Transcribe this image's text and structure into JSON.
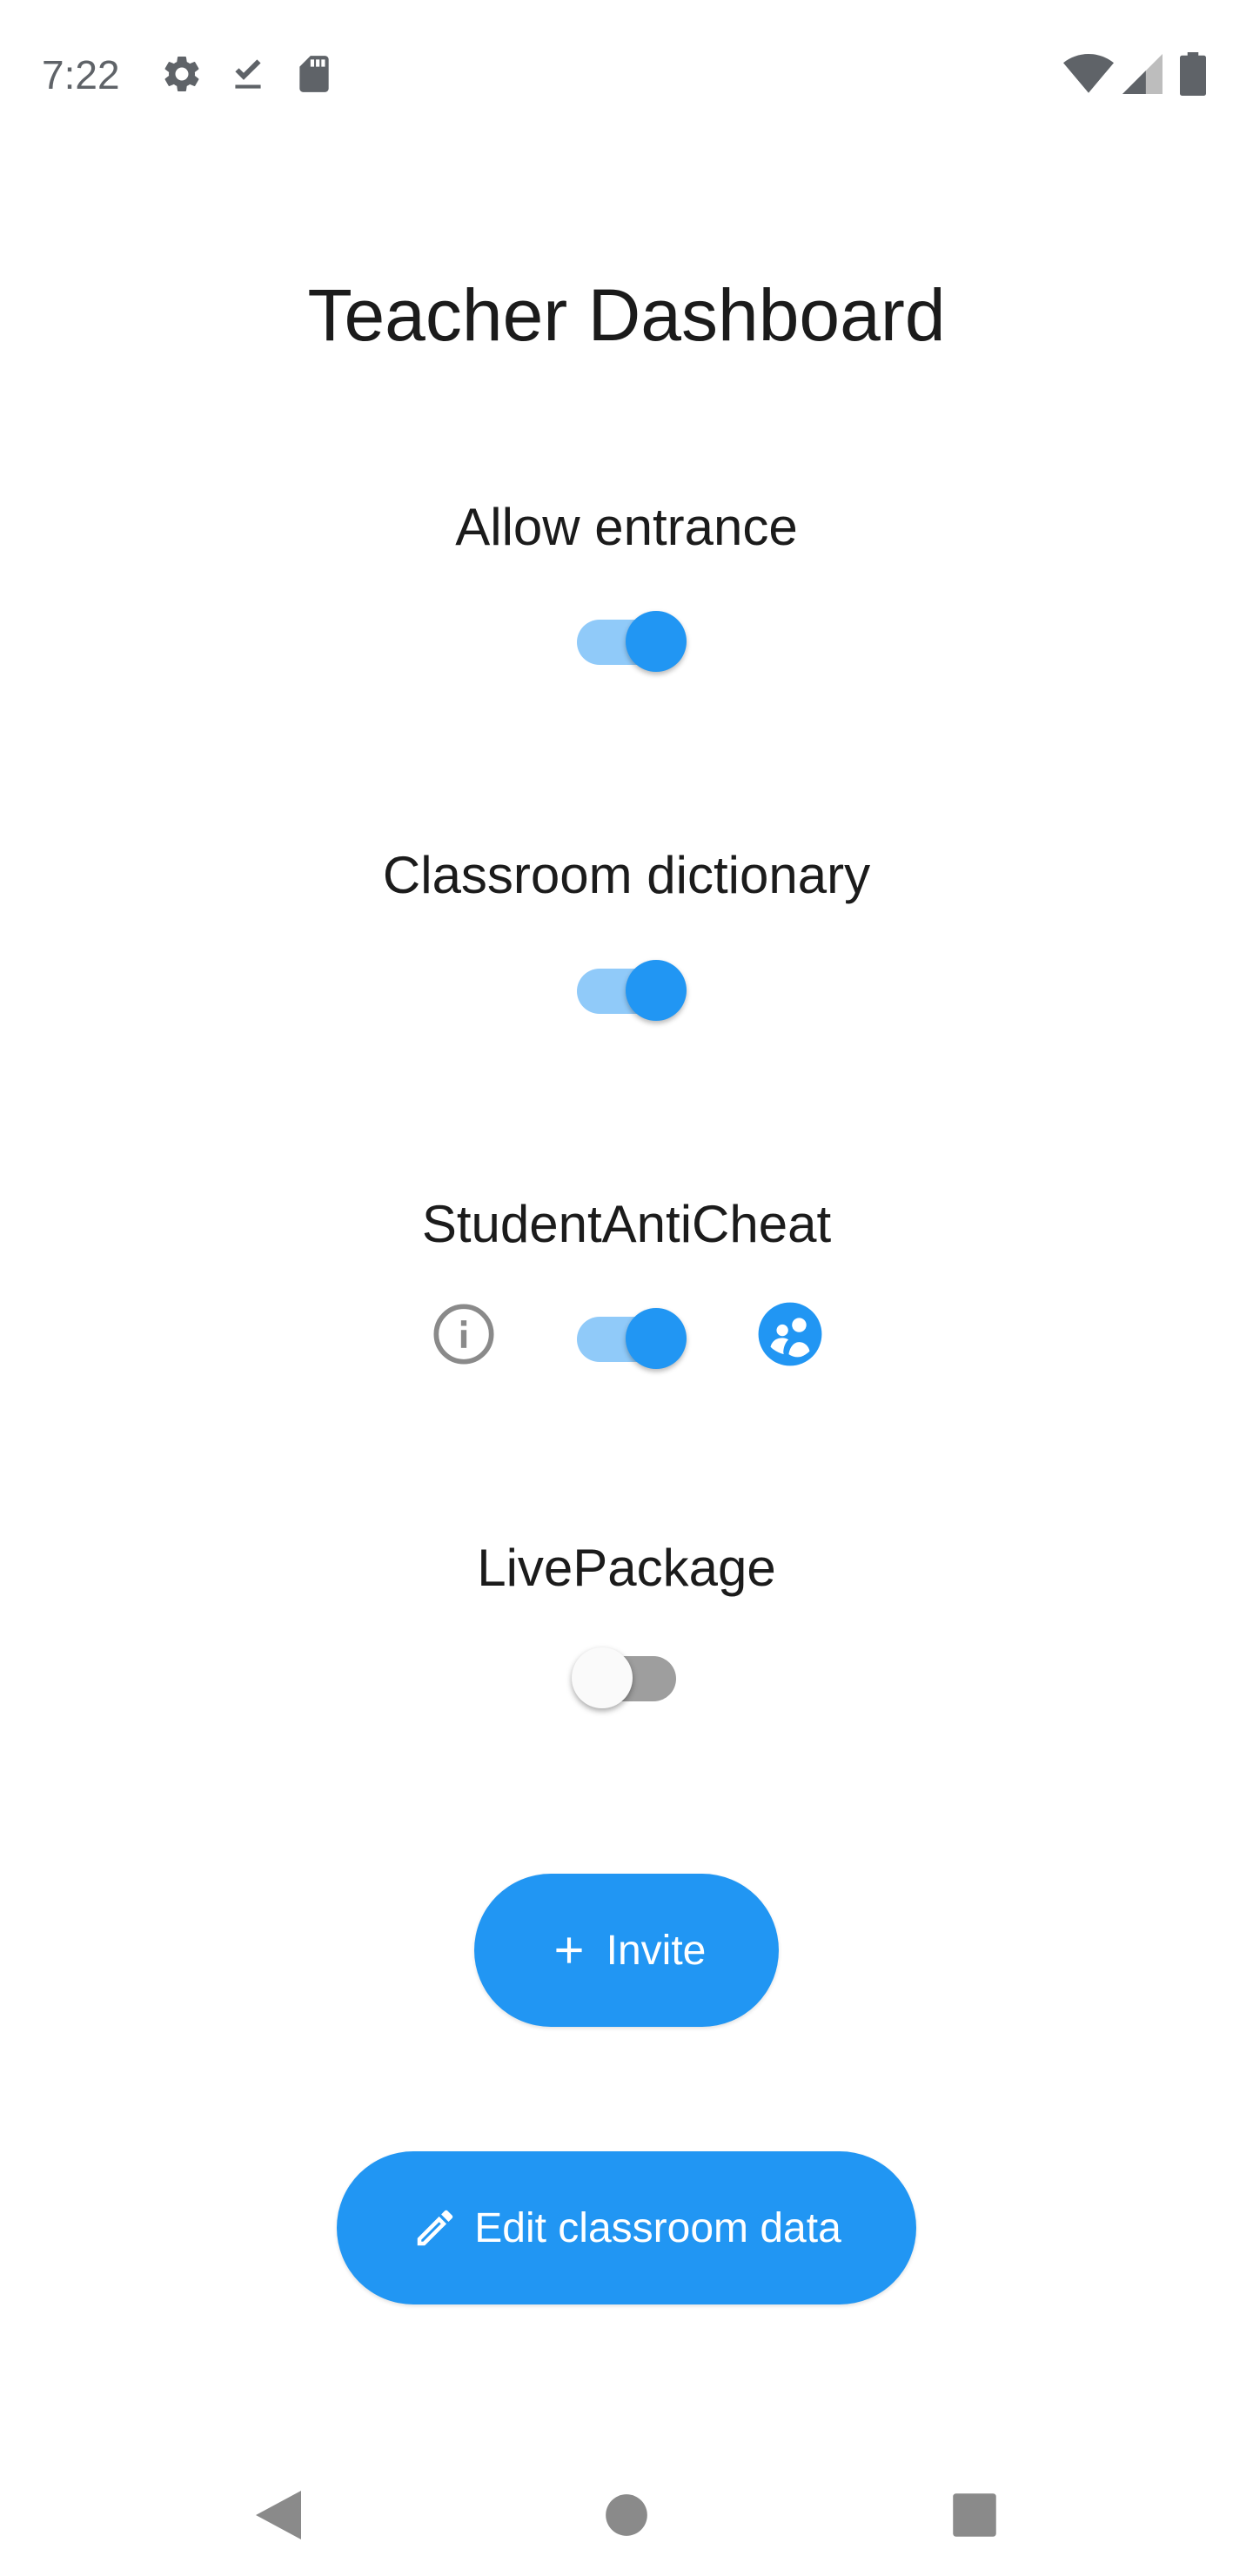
{
  "status_bar": {
    "time": "7:22",
    "left_icons": [
      "gear-icon",
      "download-done-icon",
      "sd-card-icon"
    ],
    "right_icons": [
      "wifi-icon",
      "cell-signal-icon",
      "battery-icon"
    ]
  },
  "title": "Teacher Dashboard",
  "settings": [
    {
      "label": "Allow entrance",
      "enabled": true
    },
    {
      "label": "Classroom dictionary",
      "enabled": true
    },
    {
      "label": "StudentAntiCheat",
      "enabled": true,
      "left_icon": "info-icon",
      "right_icon": "group-icon"
    },
    {
      "label": "LivePackage",
      "enabled": false
    }
  ],
  "buttons": {
    "invite": {
      "label": "Invite",
      "icon": "plus-icon"
    },
    "edit": {
      "label": "Edit classroom data",
      "icon": "pencil-icon"
    }
  },
  "nav_bar": {
    "items": [
      "back-icon",
      "home-icon",
      "recents-icon"
    ]
  },
  "colors": {
    "accent": "#2196f3",
    "accent_light": "#90caf9",
    "switch_off_track": "#9e9e9e",
    "status_icon": "#5f6368"
  }
}
